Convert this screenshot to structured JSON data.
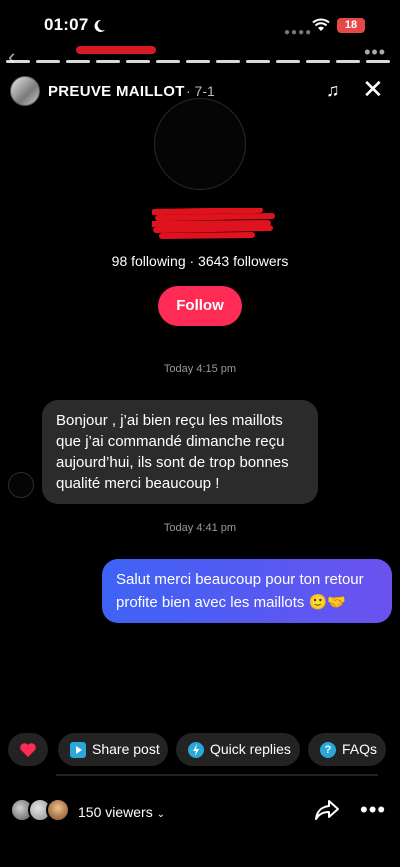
{
  "status_bar": {
    "time": "01:07",
    "battery": "18"
  },
  "header": {
    "username": "PREUVE MAILLOT",
    "meta": "· 7-1"
  },
  "profile": {
    "stats": "98 following · 3643 followers",
    "follow_label": "Follow"
  },
  "messages": [
    {
      "timestamp": "Today 4:15 pm",
      "direction": "incoming",
      "text": "Bonjour , j’ai bien reçu les maillots que j’ai commandé dimanche reçu aujourd’hui, ils sont de trop bonnes qualité merci beaucoup !"
    },
    {
      "timestamp": "Today 4:41 pm",
      "direction": "outgoing",
      "text": "Salut merci beaucoup pour ton retour profite bien avec les maillots 🙂🤝"
    }
  ],
  "actions": [
    {
      "label": "",
      "icon": "heart-icon"
    },
    {
      "label": "Share post",
      "icon": "share-post-icon"
    },
    {
      "label": "Quick replies",
      "icon": "quick-replies-icon"
    },
    {
      "label": "FAQs",
      "icon": "faq-icon"
    }
  ],
  "footer": {
    "viewers_label": "150 viewers"
  },
  "colors": {
    "follow": "#fe2c55",
    "outgoing_bubble": "#4b5bf3",
    "incoming_bubble": "#2b2b2b",
    "redaction": "#e0121e"
  }
}
